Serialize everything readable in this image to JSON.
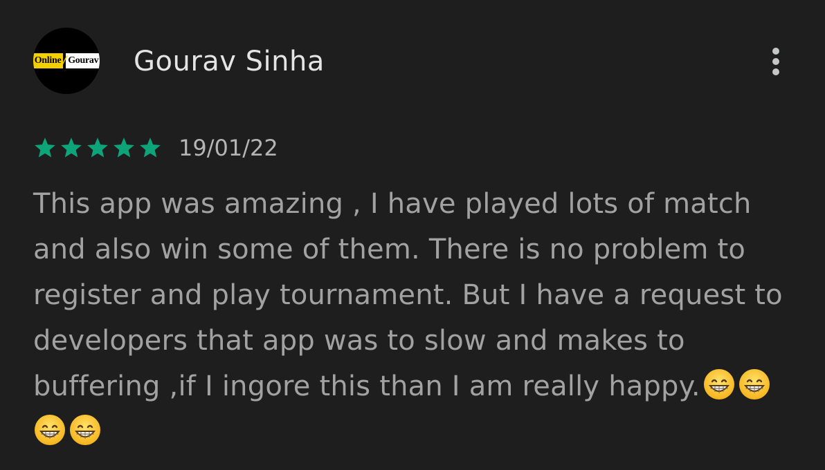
{
  "review": {
    "author": {
      "name": "Gourav Sinha",
      "avatar_logo": {
        "left_text": "Online",
        "separator": "/",
        "right_text": "Gourav"
      }
    },
    "menu_icon": "more-vert-icon",
    "rating": {
      "stars": 5,
      "max": 5,
      "star_color": "#0ea47a"
    },
    "date": "19/01/22",
    "text": "This app was amazing , I have played lots of match and also win some of them. There is no problem to register and play tournament. But I have a request to developers that app was to slow and makes to buffering ,if I ingore this than I am really happy.",
    "emojis": [
      "grinning-face-icon",
      "grinning-face-icon",
      "grinning-face-icon",
      "grinning-face-icon"
    ]
  },
  "colors": {
    "background": "#1e1e1e",
    "name": "#e4e4e4",
    "body_text": "#a2a2a2",
    "date_text": "#b5b5b5",
    "star": "#0ea47a"
  }
}
